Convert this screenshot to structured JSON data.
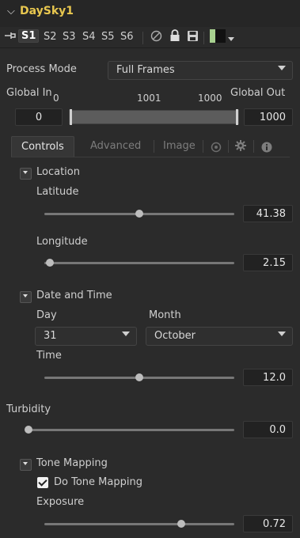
{
  "header": {
    "title": "DaySky1"
  },
  "toolbar": {
    "slots": [
      "S1",
      "S2",
      "S3",
      "S4",
      "S5",
      "S6"
    ],
    "selected_slot": "S1",
    "icons": [
      "pin-icon",
      "disable-icon",
      "lock-icon",
      "save-icon",
      "color-swatch-icon"
    ],
    "swatch_color": "#a7d08f"
  },
  "process_mode": {
    "label": "Process Mode",
    "value": "Full Frames"
  },
  "global_range": {
    "in_label": "Global In",
    "out_label": "Global Out",
    "scale_left": "0",
    "scale_mid": "1001",
    "scale_right": "1000",
    "in_value": "0",
    "out_value": "1000"
  },
  "tabs": {
    "controls": "Controls",
    "advanced": "Advanced",
    "image": "Image",
    "icon_tabs": [
      "settings-icon",
      "gear-icon",
      "info-icon"
    ]
  },
  "location": {
    "section": "Location",
    "latitude_label": "Latitude",
    "latitude_value": "41.38",
    "latitude_fraction": 0.5,
    "longitude_label": "Longitude",
    "longitude_value": "2.15",
    "longitude_fraction": 0.03
  },
  "date_time": {
    "section": "Date and Time",
    "day_label": "Day",
    "day_value": "31",
    "month_label": "Month",
    "month_value": "October",
    "time_label": "Time",
    "time_value": "12.0",
    "time_fraction": 0.5
  },
  "turbidity": {
    "label": "Turbidity",
    "value": "0.0",
    "fraction": 0.0
  },
  "tone_mapping": {
    "section": "Tone Mapping",
    "checkbox_label": "Do Tone Mapping",
    "checkbox_checked": true,
    "exposure_label": "Exposure",
    "exposure_value": "0.72",
    "exposure_fraction": 0.72
  }
}
